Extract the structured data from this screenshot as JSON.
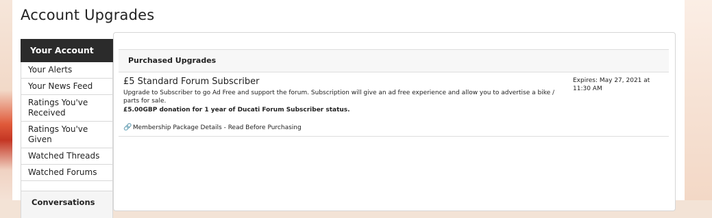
{
  "page": {
    "title": "Account Upgrades"
  },
  "sidebar": {
    "header": "Your Account",
    "items": [
      {
        "label": "Your Alerts"
      },
      {
        "label": "Your News Feed"
      },
      {
        "label": "Ratings You've Received"
      },
      {
        "label": "Ratings You've Given"
      },
      {
        "label": "Watched Threads"
      },
      {
        "label": "Watched Forums"
      }
    ],
    "subheader": "Conversations"
  },
  "main": {
    "section_title": "Purchased Upgrades",
    "upgrade": {
      "title": "£5 Standard Forum Subscriber",
      "description": "Upgrade to Subscriber to go Ad Free and support the forum. Subscription will give an ad free experience and allow you to advertise a bike / parts for sale.",
      "price_text": "£5.00GBP donation for 1 year of Ducati Forum Subscriber status.",
      "link_icon": "link-icon",
      "link_text": "Membership Package Details - Read Before Purchasing",
      "expires": "Expires: May 27, 2021 at 11:30 AM"
    }
  }
}
